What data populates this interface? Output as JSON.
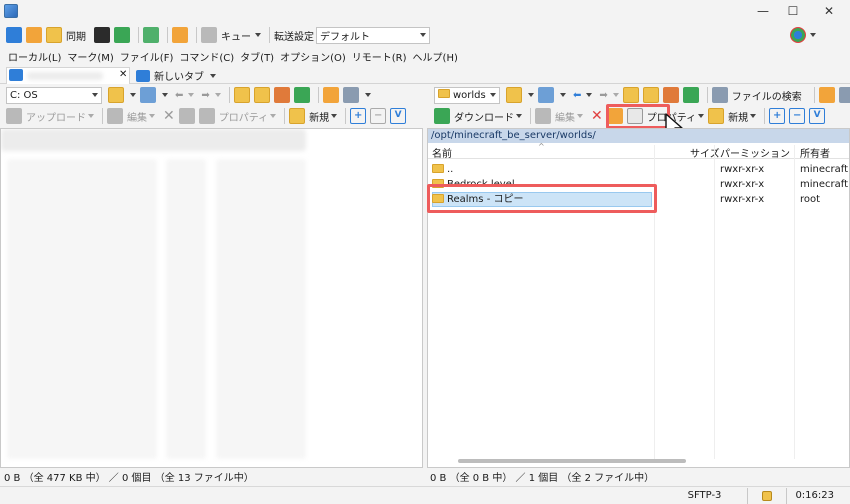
{
  "titlebar": {
    "minimize": "—",
    "maximize": "☐",
    "close": "✕"
  },
  "toolbar1": {
    "sync": "同期",
    "queue": "キュー",
    "transfer_setting_label": "転送設定",
    "transfer_setting_value": "デフォルト"
  },
  "menu": [
    "ローカル(L)",
    "マーク(M)",
    "ファイル(F)",
    "コマンド(C)",
    "タブ(T)",
    "オプション(O)",
    "リモート(R)",
    "ヘルプ(H)"
  ],
  "tabs": {
    "close": "✕",
    "new_tab": "新しいタブ"
  },
  "left": {
    "drive": "C: OS",
    "upload": "アップロード",
    "edit": "編集",
    "properties": "プロパティ",
    "new": "新規",
    "status": "0 B （全 477 KB 中） ／ 0 個目 （全 13 ファイル中）"
  },
  "right": {
    "folder": "worlds",
    "find_files": "ファイルの検索",
    "download": "ダウンロード",
    "edit": "編集",
    "properties": "プロパティ",
    "new": "新規",
    "path": "/opt/minecraft_be_server/worlds/",
    "columns": {
      "name": "名前",
      "size": "サイズ",
      "perm": "パーミッション",
      "owner": "所有者"
    },
    "rows": [
      {
        "name": "..",
        "perm": "rwxr-xr-x",
        "owner": "minecraft"
      },
      {
        "name": "Bedrock level",
        "perm": "rwxr-xr-x",
        "owner": "minecraft"
      },
      {
        "name": "Realms - コピー",
        "perm": "rwxr-xr-x",
        "owner": "root"
      }
    ],
    "status": "0 B （全 0 B 中） ／ 1 個目 （全 2 ファイル中）"
  },
  "statusbar": {
    "protocol": "SFTP-3",
    "time": "0:16:23"
  }
}
